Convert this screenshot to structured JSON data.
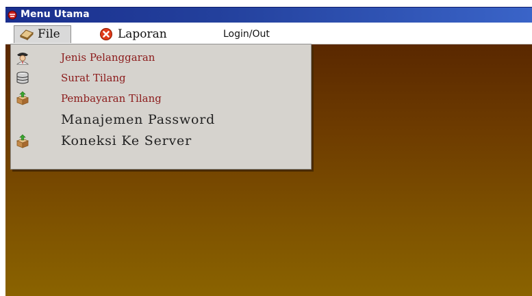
{
  "window": {
    "title": "Menu Utama"
  },
  "menubar": {
    "items": [
      {
        "label": "File",
        "icon": "book-icon"
      },
      {
        "label": "Laporan",
        "icon": "red-x-icon"
      },
      {
        "label": "Login/Out"
      }
    ]
  },
  "file_menu": {
    "items": [
      {
        "label": "Jenis Pelanggaran",
        "icon": "officer-icon"
      },
      {
        "label": "Surat Tilang",
        "icon": "database-icon"
      },
      {
        "label": "Pembayaran Tilang",
        "icon": "package-icon"
      },
      {
        "label": "Manajemen Password"
      },
      {
        "label": "Koneksi Ke Server",
        "icon": "package-icon"
      }
    ]
  },
  "colors": {
    "titlebar": "#1a2f8e",
    "content_bg_top": "#5a2800",
    "content_bg_bottom": "#8a6300",
    "menu_bg": "#d6d3ce",
    "red_text": "#8b1a1a"
  }
}
